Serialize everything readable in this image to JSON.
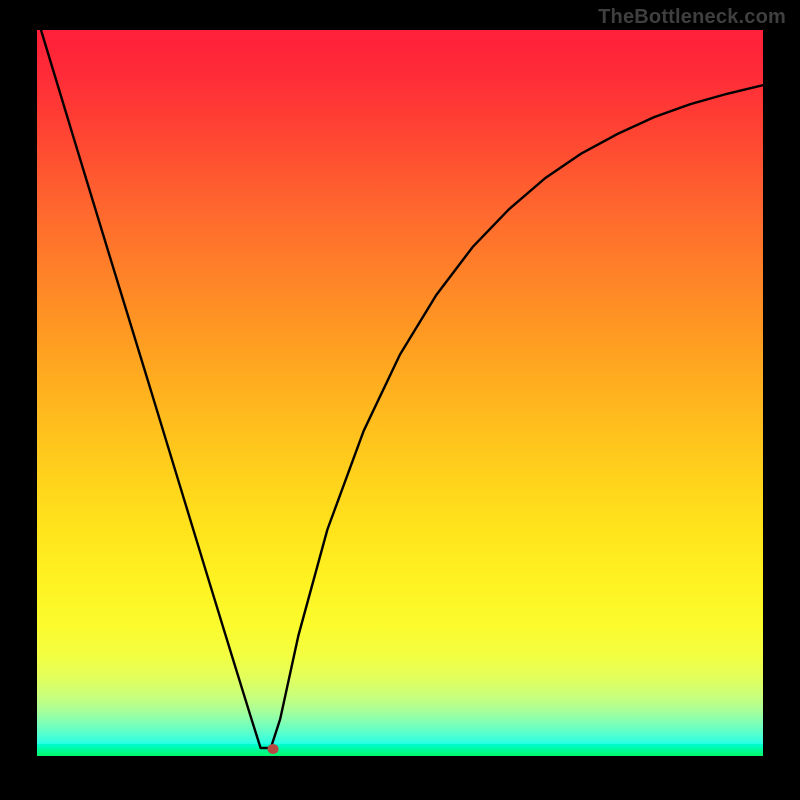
{
  "watermark": "TheBottleneck.com",
  "marker": {
    "x_pct": 32.5,
    "y_pct": 99.0
  },
  "chart_data": {
    "type": "line",
    "title": "",
    "xlabel": "",
    "ylabel": "",
    "xlim": [
      0,
      100
    ],
    "ylim": [
      0,
      100
    ],
    "grid": false,
    "background": "red-yellow-green linear gradient (bottleneck heatmap)",
    "series": [
      {
        "name": "bottleneck-curve",
        "x": [
          0.55,
          5,
          10,
          15,
          20,
          24,
          27,
          29.5,
          30.8,
          32.2,
          33.5,
          36,
          40,
          45,
          50,
          55,
          60,
          65,
          70,
          75,
          80,
          85,
          90,
          95,
          100
        ],
        "y": [
          100,
          85.3,
          68.9,
          52.6,
          36.2,
          23.1,
          13.3,
          5.2,
          1.1,
          1.1,
          5.1,
          16.6,
          31.2,
          44.8,
          55.3,
          63.5,
          70.1,
          75.3,
          79.6,
          83.0,
          85.7,
          88.0,
          89.8,
          91.2,
          92.4
        ]
      }
    ],
    "annotations": [
      {
        "type": "marker",
        "x": 32.5,
        "y": 1.0,
        "color": "#b84842",
        "shape": "ellipse"
      }
    ],
    "notes": "V-shaped curve indicating bottleneck minimum near x≈31–32%. Background gradient encodes bottleneck severity (red=high, green=low)."
  }
}
